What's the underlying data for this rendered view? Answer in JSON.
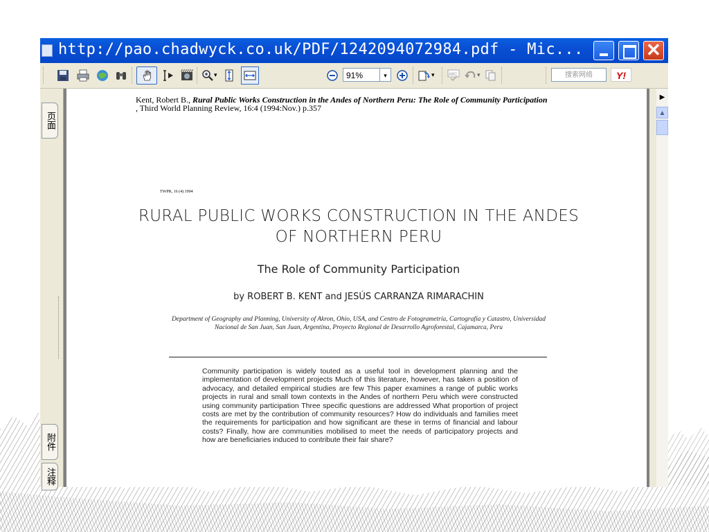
{
  "window": {
    "title": "http://pao.chadwyck.co.uk/PDF/1242094072984.pdf - Mic..."
  },
  "toolbar": {
    "zoom_value": "91%",
    "search_placeholder": "搜索网络",
    "yahoo_label": "Y!",
    "icons": [
      "save-icon",
      "print-icon",
      "email-icon",
      "find-icon",
      "hand-tool-icon",
      "select-text-icon",
      "snapshot-icon",
      "zoom-in-icon",
      "fit-page-icon",
      "fit-width-icon",
      "zoom-out-minus-icon",
      "zoom-in-plus-icon",
      "rotate-icon",
      "spelling-icon",
      "undo-icon",
      "copy-icon"
    ]
  },
  "left_nav": {
    "tabs": [
      "页面",
      "附件",
      "注释"
    ]
  },
  "document": {
    "citation_author": "Kent, Robert B., ",
    "citation_title": "Rural Public Works Construction in the Andes of Northern Peru: The Role of Community Participation",
    "citation_rest": " , Third World Planning Review, 16:4 (1994:Nov.) p.357",
    "journal_tag": "TWPR, 16 (4) 1994",
    "title": "RURAL PUBLIC WORKS CONSTRUCTION IN THE ANDES OF NORTHERN PERU",
    "subtitle": "The Role of Community Participation",
    "authors": "by ROBERT B. KENT and JESÚS CARRANZA RIMARACHIN",
    "department": "Department of Geography and Planning, University of Akron, Ohio, USA, and Centro de Fotogrametría, Cartografía y Catastro, Universidad Nacional de San Juan, San Juan, Argentina, Proyecto Regional de Desarrollo Agroforestal, Cajamarca, Peru",
    "abstract": "Community participation is widely touted as a useful tool in development planning and the implementation of development projects Much of this literature, however, has taken a position of advocacy, and detailed empirical studies are few This paper examines a range of public works projects in rural and small town contexts in the Andes of northern Peru which were constructed using community participation Three specific questions are addressed What proportion of project costs are met by the contribution of community resources? How do individuals and families meet the requirements for participation and how significant are these in terms of financial and labour costs? Finally, how are communities mobilised to meet the needs of participatory projects and how are beneficiaries induced to contribute their fair share?"
  },
  "colors": {
    "titlebar": "#0a4fd4",
    "close_button": "#c8391b",
    "toolbar_bg": "#ece9d8"
  }
}
